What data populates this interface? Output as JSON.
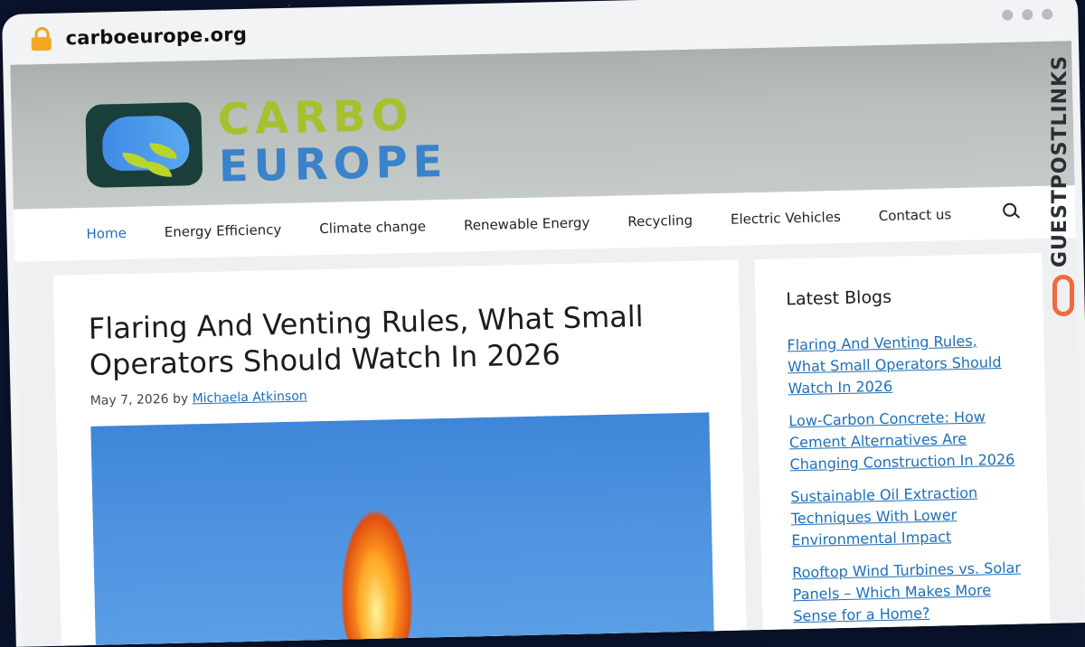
{
  "browser": {
    "url": "carboeurope.org"
  },
  "brand": {
    "line1": "CARBO",
    "line2": "EUROPE"
  },
  "nav": {
    "items": [
      {
        "label": "Home",
        "active": true
      },
      {
        "label": "Energy Efficiency",
        "active": false
      },
      {
        "label": "Climate change",
        "active": false
      },
      {
        "label": "Renewable Energy",
        "active": false
      },
      {
        "label": "Recycling",
        "active": false
      },
      {
        "label": "Electric Vehicles",
        "active": false
      },
      {
        "label": "Contact us",
        "active": false
      }
    ]
  },
  "article": {
    "title": "Flaring And Venting Rules, What Small Operators Should Watch In 2026",
    "date": "May 7, 2026",
    "by": "by",
    "author": "Michaela Atkinson"
  },
  "sidebar": {
    "heading": "Latest Blogs",
    "links": [
      "Flaring And Venting Rules, What Small Operators Should Watch In 2026",
      "Low-Carbon Concrete: How Cement Alternatives Are Changing Construction In 2026",
      "Sustainable Oil Extraction Techniques With Lower Environmental Impact",
      "Rooftop Wind Turbines vs. Solar Panels – Which Makes More Sense for a Home?"
    ]
  },
  "watermark": {
    "text": "GUESTPOSTLINKS"
  },
  "colors": {
    "accent": "#1e6fb8",
    "brand_green": "#a7c12e",
    "brand_blue": "#3a82c9",
    "watermark_orange": "#ef6a3c"
  }
}
